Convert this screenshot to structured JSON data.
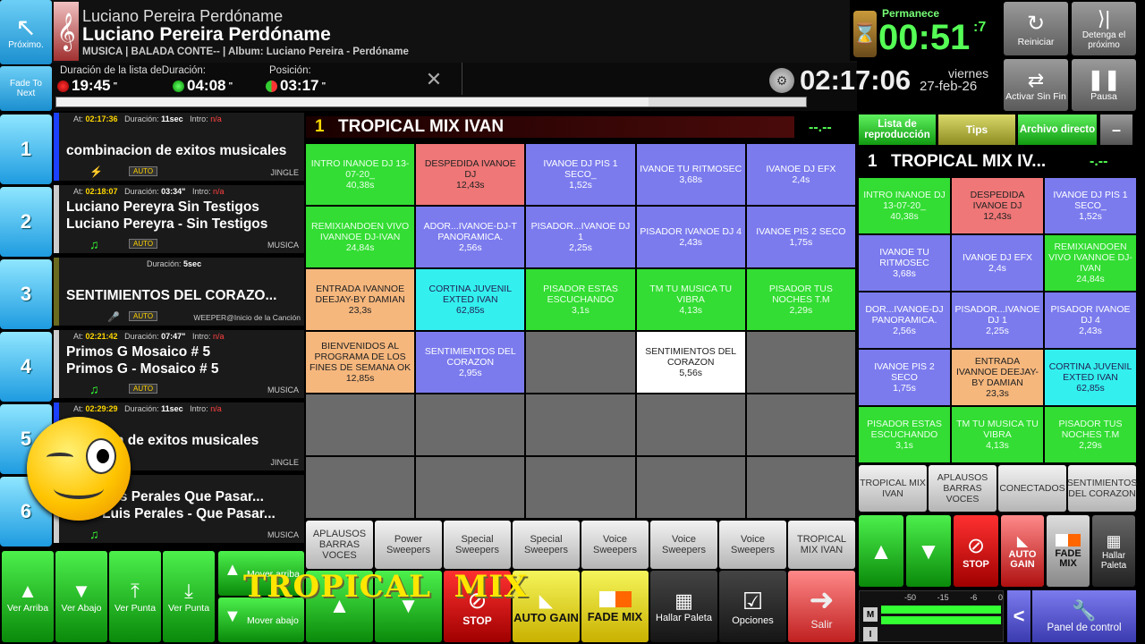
{
  "header": {
    "prev_label": "Próximo.",
    "fade_label": "Fade To Next",
    "artist_line": "Luciano Pereira   Perdóname",
    "title_line": "Luciano Pereira   Perdóname",
    "info_line": "MUSICA | BALADA CONTE-- | Album: Luciano Pereira - Perdóname",
    "dur_label": "Duración de la lista deDuración:",
    "pos_label": "Posición:",
    "list_duration": "19:45",
    "list_duration_frac": "\"",
    "track_duration": "04:08",
    "track_duration_frac": "\"",
    "position": "03:17",
    "position_frac": "\"",
    "clock": "02:17:06",
    "day": "viernes",
    "date": "27-feb-26",
    "remain_label": "Permanece",
    "remain": "00:51",
    "remain_frac": ":7",
    "restart_label": "Reiniciar",
    "stop_next_label": "Detenga el próximo",
    "loop_label": "Activar Sin Fin",
    "pause_label": "Pausa"
  },
  "playlist": [
    {
      "num": "1",
      "at": "02:17:36",
      "duration": "11sec",
      "intro": "n/a",
      "t1": "combinacion de exitos musicales",
      "t2": "",
      "tag": "JINGLE",
      "color": "#1b40ff"
    },
    {
      "num": "2",
      "at": "02:18:07",
      "duration": "03:34\"",
      "intro": "n/a",
      "t1": "Luciano Pereyra   Sin Testigos",
      "t2": "Luciano Pereyra - Sin Testigos",
      "tag": "MUSICA",
      "color": "#cccccc"
    },
    {
      "num": "3",
      "at": "",
      "duration": "5sec",
      "intro": "",
      "t1": "SENTIMIENTOS DEL CORAZO...",
      "t2": "",
      "tag": "WEEPER@Inicio de la Canción",
      "color": "#6a6a20"
    },
    {
      "num": "4",
      "at": "02:21:42",
      "duration": "07:47\"",
      "intro": "n/a",
      "t1": "Primos G   Mosaico # 5",
      "t2": "Primos G - Mosaico # 5",
      "tag": "MUSICA",
      "color": "#cccccc"
    },
    {
      "num": "5",
      "at": "02:29:29",
      "duration": "11sec",
      "intro": "n/a",
      "t1": "acion de exitos musicales",
      "t2": "",
      "tag": "JINGLE",
      "color": "#1b40ff"
    },
    {
      "num": "6",
      "at": "",
      "duration": "",
      "intro": "",
      "t1": "uis Perales   Que Pasar...",
      "t2": "Luis Perales - Que Pasar...",
      "tag": "MUSICA",
      "color": "#cccccc"
    }
  ],
  "auto_label": "AUTO",
  "at_label": "At:",
  "dur_word": "Duración:",
  "intro_word": "Intro:",
  "palette": {
    "num": "1",
    "title": "TROPICAL MIX IVAN",
    "cells": [
      {
        "n": "INTRO INANOE DJ 13-07-20_",
        "d": "40,38s",
        "c": "#33dd33",
        "fg": "#eaffea"
      },
      {
        "n": "DESPEDIDA IVANOE DJ",
        "d": "12,43s",
        "c": "#ef7777",
        "fg": "#222"
      },
      {
        "n": "IVANOE DJ PIS 1 SECO_",
        "d": "1,52s",
        "c": "#7b7bee",
        "fg": "#fff"
      },
      {
        "n": "IVANOE TU RITMOSEC",
        "d": "3,68s",
        "c": "#7b7bee",
        "fg": "#fff"
      },
      {
        "n": "IVANOE DJ EFX",
        "d": "2,4s",
        "c": "#7b7bee",
        "fg": "#fff"
      },
      {
        "n": "REMIXIANDOEN VIVO IVANNOE DJ-IVAN",
        "d": "24,84s",
        "c": "#33dd33",
        "fg": "#eaffea"
      },
      {
        "n": "ADOR...IVANOE-DJ-T PANORAMICA.",
        "d": "2,56s",
        "c": "#7b7bee",
        "fg": "#fff"
      },
      {
        "n": "PISADOR...IVANOE DJ  1",
        "d": "2,25s",
        "c": "#7b7bee",
        "fg": "#fff"
      },
      {
        "n": "PISADOR IVANOE DJ 4",
        "d": "2,43s",
        "c": "#7b7bee",
        "fg": "#fff"
      },
      {
        "n": "IVANOE PIS 2 SECO",
        "d": "1,75s",
        "c": "#7b7bee",
        "fg": "#fff"
      },
      {
        "n": "ENTRADA IVANNOE DEEJAY-BY DAMIAN",
        "d": "23,3s",
        "c": "#f6b77d",
        "fg": "#222"
      },
      {
        "n": "CORTINA JUVENIL EXTED IVAN",
        "d": "62,85s",
        "c": "#33f0ef",
        "fg": "#225"
      },
      {
        "n": "PISADOR ESTAS ESCUCHANDO",
        "d": "3,1s",
        "c": "#33dd33",
        "fg": "#eaffea"
      },
      {
        "n": "TM TU MUSICA TU VIBRA",
        "d": "4,13s",
        "c": "#33dd33",
        "fg": "#eaffea"
      },
      {
        "n": "PISADOR TUS NOCHES T.M",
        "d": "2,29s",
        "c": "#33dd33",
        "fg": "#eaffea"
      },
      {
        "n": "BIENVENIDOS AL PROGRAMA DE LOS FINES DE SEMANA OK",
        "d": "12,85s",
        "c": "#f6b77d",
        "fg": "#222"
      },
      {
        "n": "SENTIMIENTOS DEL CORAZON",
        "d": "2,95s",
        "c": "#7b7bee",
        "fg": "#fff"
      },
      {
        "n": "",
        "d": "",
        "c": "#6b6b6b",
        "fg": "#fff"
      },
      {
        "n": "SENTIMIENTOS DEL CORAZON",
        "d": "5,56s",
        "c": "#ffffff",
        "fg": "#222"
      },
      {
        "n": "",
        "d": "",
        "c": "#6b6b6b",
        "fg": "#fff"
      }
    ],
    "tabs": [
      "APLAUSOS BARRAS VOCES",
      "Power Sweepers",
      "Special Sweepers",
      "Special Sweepers",
      "Voice Sweepers",
      "Voice Sweepers",
      "Voice Sweepers",
      "TROPICAL MIX IVAN"
    ]
  },
  "right_panel": {
    "tab_playlist": "Lista de reproducción",
    "tab_tips": "Tips",
    "tab_archive": "Archivo directo",
    "minus": "–",
    "num": "1",
    "title": "TROPICAL MIX IV...",
    "cells": [
      {
        "n": "INTRO INANOE DJ 13-07-20_",
        "d": "40,38s",
        "c": "#33dd33",
        "fg": "#eaffea"
      },
      {
        "n": "DESPEDIDA IVANOE DJ",
        "d": "12,43s",
        "c": "#ef7777",
        "fg": "#222"
      },
      {
        "n": "IVANOE DJ PIS 1 SECO_",
        "d": "1,52s",
        "c": "#7b7bee",
        "fg": "#fff"
      },
      {
        "n": "IVANOE TU RITMOSEC",
        "d": "3,68s",
        "c": "#7b7bee",
        "fg": "#fff"
      },
      {
        "n": "IVANOE DJ EFX",
        "d": "2,4s",
        "c": "#7b7bee",
        "fg": "#fff"
      },
      {
        "n": "REMIXIANDOEN VIVO IVANNOE DJ-IVAN",
        "d": "24,84s",
        "c": "#33dd33",
        "fg": "#eaffea"
      },
      {
        "n": "DOR...IVANOE-DJ PANORAMICA.",
        "d": "2,56s",
        "c": "#7b7bee",
        "fg": "#fff"
      },
      {
        "n": "PISADOR...IVANOE DJ  1",
        "d": "2,25s",
        "c": "#7b7bee",
        "fg": "#fff"
      },
      {
        "n": "PISADOR IVANOE DJ 4",
        "d": "2,43s",
        "c": "#7b7bee",
        "fg": "#fff"
      },
      {
        "n": "IVANOE PIS 2 SECO",
        "d": "1,75s",
        "c": "#7b7bee",
        "fg": "#fff"
      },
      {
        "n": "ENTRADA IVANNOE DEEJAY-BY DAMIAN",
        "d": "23,3s",
        "c": "#f6b77d",
        "fg": "#222"
      },
      {
        "n": "CORTINA JUVENIL EXTED IVAN",
        "d": "62,85s",
        "c": "#33f0ef",
        "fg": "#225"
      },
      {
        "n": "PISADOR ESTAS ESCUCHANDO",
        "d": "3,1s",
        "c": "#33dd33",
        "fg": "#eaffea"
      },
      {
        "n": "TM TU MUSICA TU VIBRA",
        "d": "4,13s",
        "c": "#33dd33",
        "fg": "#eaffea"
      },
      {
        "n": "PISADOR TUS NOCHES T.M",
        "d": "2,29s",
        "c": "#33dd33",
        "fg": "#eaffea"
      }
    ],
    "tabs": [
      "TROPICAL MIX IVAN",
      "APLAUSOS BARRAS VOCES",
      "CONECTADOS",
      "SENTIMIENTOS DEL CORAZON"
    ],
    "stop": "STOP",
    "auto_gain": "AUTO GAIN",
    "fade_mix": "FADE MIX",
    "find_palette": "Hallar Paleta",
    "meter_ticks": [
      "-50",
      "-15",
      "-6",
      "0"
    ],
    "m_label": "M",
    "i_label": "I",
    "back": "<",
    "control_panel": "Panel de control"
  },
  "bottom": {
    "up": "Ver Arriba",
    "down": "Ver Abajo",
    "point": "Ver Punta",
    "point2": "Ver Punta",
    "move_up": "Mover arriba",
    "move_down": "Mover abajo",
    "overlay": "TROPICAL  MIX",
    "stop": "STOP",
    "auto_gain": "AUTO GAIN",
    "fade_mix": "FADE MIX",
    "find_palette": "Hallar Paleta",
    "options": "Opciones",
    "exit": "Salir"
  }
}
